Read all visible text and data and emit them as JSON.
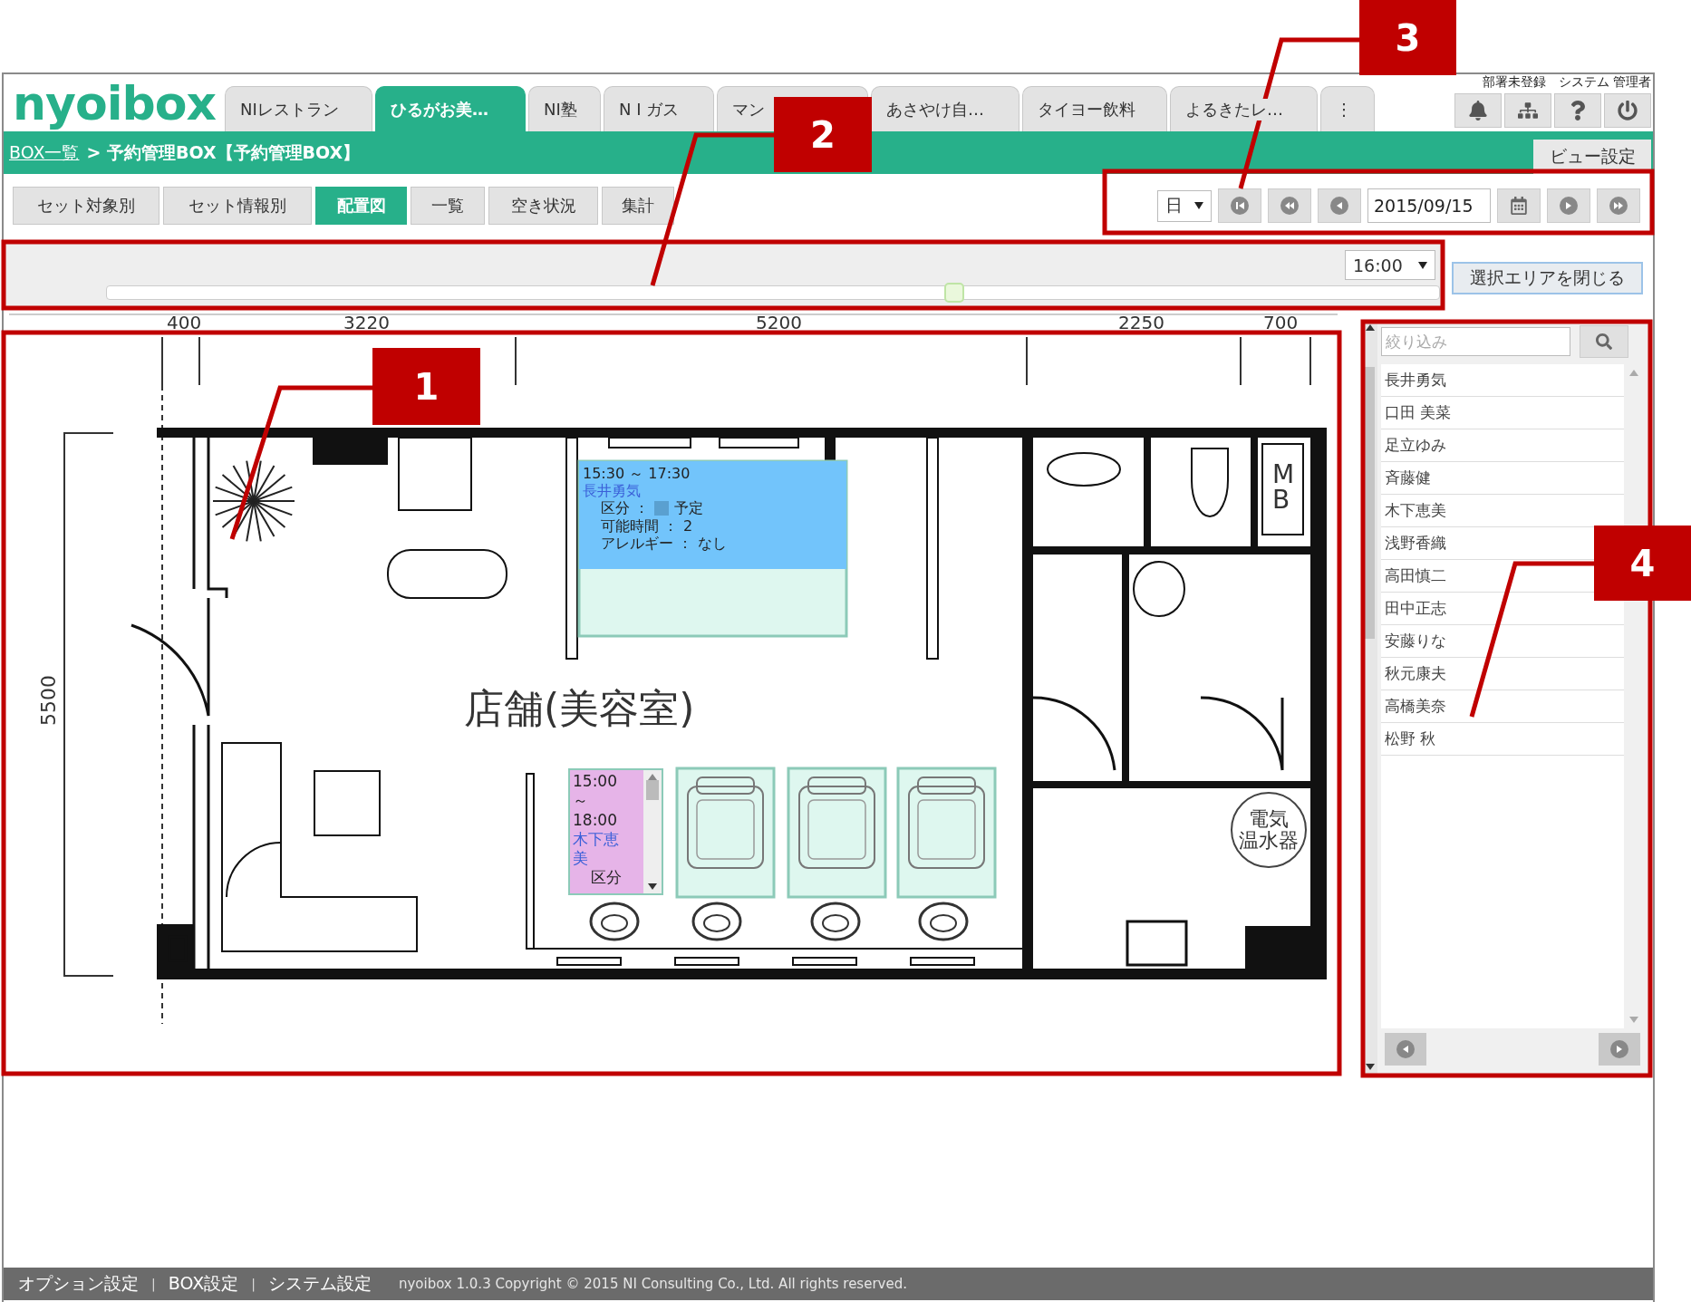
{
  "logo": {
    "text": "nyoibox"
  },
  "app_tabs": [
    {
      "label": "NIレストラン",
      "selected": false
    },
    {
      "label": "ひるがお美…",
      "selected": true
    },
    {
      "label": "NI塾",
      "selected": false
    },
    {
      "label": "N I ガス",
      "selected": false
    },
    {
      "label": "マン",
      "selected": false
    },
    {
      "label": "あさやけ自…",
      "selected": false
    },
    {
      "label": "タイヨー飲料",
      "selected": false
    },
    {
      "label": "よるきたレ…",
      "selected": false
    },
    {
      "label": "⋮",
      "selected": false
    }
  ],
  "user": {
    "department": "部署未登録",
    "name": "システム 管理者"
  },
  "breadcrumb": {
    "link": "BOX一覧",
    "rest": "> 予約管理BOX【予約管理BOX】"
  },
  "view_settings_button": "ビュー設定",
  "view_tabs": [
    {
      "label": "セット対象別",
      "selected": false
    },
    {
      "label": "セット情報別",
      "selected": false
    },
    {
      "label": "配置図",
      "selected": true
    },
    {
      "label": "一覧",
      "selected": false
    },
    {
      "label": "空き状況",
      "selected": false
    },
    {
      "label": "集計",
      "selected": false
    }
  ],
  "date_nav": {
    "unit": "日",
    "date": "2015/09/15"
  },
  "time_bar": {
    "time": "16:00",
    "level": 0.636
  },
  "close_area_button": "選択エリアを閉じる",
  "floor_plan": {
    "ruler_labels": [
      "400",
      "3220",
      "5200",
      "2250",
      "700"
    ],
    "height_label": "5500",
    "room_name": "店舗(美容室)",
    "mb_label": "MB",
    "heater_lines": [
      "電気",
      "温水器"
    ],
    "reservations": [
      {
        "kind": "card",
        "color": "#72c4fb",
        "time": "15:30 ～ 17:30",
        "name": "長井勇気",
        "details": [
          {
            "label": "区分 ：",
            "value": "予定",
            "swatch": true
          },
          {
            "label": "可能時間 ：",
            "value": "2",
            "swatch": false
          },
          {
            "label": "アレルギー ：",
            "value": "なし",
            "swatch": false
          }
        ]
      },
      {
        "kind": "scroll",
        "color": "#e6b4e8",
        "time_lines": [
          "15:00",
          "～",
          "18:00"
        ],
        "name_lines": [
          "木下恵",
          "美"
        ],
        "detail_lines": [
          "区分"
        ]
      }
    ]
  },
  "sidebar": {
    "search_placeholder": "絞り込み",
    "people": [
      "長井勇気",
      "口田 美菜",
      "足立ゆみ",
      "斉藤健",
      "木下恵美",
      "浅野香織",
      "高田慎二",
      "田中正志",
      "安藤りな",
      "秋元康夫",
      "高橋美奈",
      "松野 秋"
    ]
  },
  "footer": {
    "items": [
      {
        "kind": "link",
        "text": "オプション設定"
      },
      {
        "kind": "separator",
        "text": "|"
      },
      {
        "kind": "link",
        "text": "BOX設定"
      },
      {
        "kind": "separator",
        "text": "|"
      },
      {
        "kind": "link",
        "text": "システム設定"
      }
    ],
    "copyright": "nyoibox 1.0.3 Copyright © 2015 NI Consulting Co., Ltd. All rights reserved."
  },
  "annotations": [
    {
      "number": "1"
    },
    {
      "number": "2"
    },
    {
      "number": "3"
    },
    {
      "number": "4"
    }
  ]
}
